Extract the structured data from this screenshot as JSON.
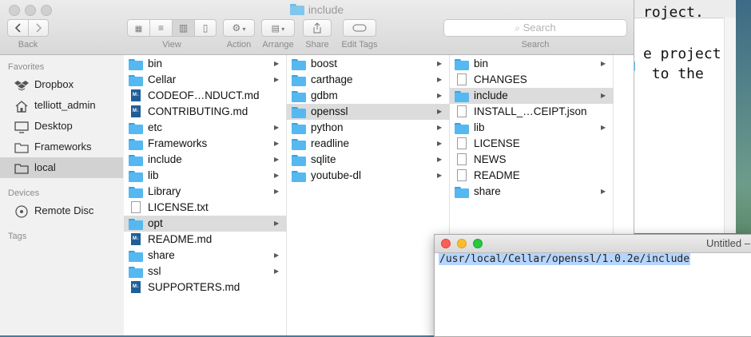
{
  "finder": {
    "title": "include",
    "toolbar": {
      "back_label": "Back",
      "view_label": "View",
      "action_label": "Action",
      "arrange_label": "Arrange",
      "share_label": "Share",
      "edit_tags_label": "Edit Tags",
      "search_placeholder": "Search",
      "search_label": "Search"
    },
    "sidebar": {
      "favorites_header": "Favorites",
      "favorites": [
        {
          "label": "Dropbox",
          "icon": "dropbox-icon"
        },
        {
          "label": "telliott_admin",
          "icon": "home-icon"
        },
        {
          "label": "Desktop",
          "icon": "desktop-icon"
        },
        {
          "label": "Frameworks",
          "icon": "folder-icon"
        },
        {
          "label": "local",
          "icon": "folder-icon",
          "selected": true
        }
      ],
      "devices_header": "Devices",
      "devices": [
        {
          "label": "Remote Disc",
          "icon": "disc-icon"
        }
      ],
      "tags_header": "Tags"
    },
    "columns": [
      {
        "items": [
          {
            "label": "bin",
            "type": "folder",
            "arrow": true
          },
          {
            "label": "Cellar",
            "type": "folder",
            "arrow": true
          },
          {
            "label": "CODEOF…NDUCT.md",
            "type": "md",
            "arrow": false
          },
          {
            "label": "CONTRIBUTING.md",
            "type": "md",
            "arrow": false
          },
          {
            "label": "etc",
            "type": "folder",
            "arrow": true
          },
          {
            "label": "Frameworks",
            "type": "folder",
            "arrow": true
          },
          {
            "label": "include",
            "type": "folder",
            "arrow": true
          },
          {
            "label": "lib",
            "type": "folder",
            "arrow": true
          },
          {
            "label": "Library",
            "type": "folder",
            "arrow": true
          },
          {
            "label": "LICENSE.txt",
            "type": "doc",
            "arrow": false
          },
          {
            "label": "opt",
            "type": "folder",
            "arrow": true,
            "selected": true
          },
          {
            "label": "README.md",
            "type": "md",
            "arrow": false
          },
          {
            "label": "share",
            "type": "folder",
            "arrow": true
          },
          {
            "label": "ssl",
            "type": "folder",
            "arrow": true
          },
          {
            "label": "SUPPORTERS.md",
            "type": "md",
            "arrow": false
          }
        ]
      },
      {
        "items": [
          {
            "label": "boost",
            "type": "folder",
            "arrow": true
          },
          {
            "label": "carthage",
            "type": "folder",
            "arrow": true
          },
          {
            "label": "gdbm",
            "type": "folder",
            "arrow": true
          },
          {
            "label": "openssl",
            "type": "folder",
            "arrow": true,
            "selected": true
          },
          {
            "label": "python",
            "type": "folder",
            "arrow": true
          },
          {
            "label": "readline",
            "type": "folder",
            "arrow": true
          },
          {
            "label": "sqlite",
            "type": "folder",
            "arrow": true
          },
          {
            "label": "youtube-dl",
            "type": "folder",
            "arrow": true
          }
        ]
      },
      {
        "items": [
          {
            "label": "bin",
            "type": "folder",
            "arrow": true
          },
          {
            "label": "CHANGES",
            "type": "doc",
            "arrow": false
          },
          {
            "label": "include",
            "type": "folder",
            "arrow": true,
            "selected": true
          },
          {
            "label": "INSTALL_…CEIPT.json",
            "type": "doc",
            "arrow": false
          },
          {
            "label": "lib",
            "type": "folder",
            "arrow": true
          },
          {
            "label": "LICENSE",
            "type": "doc",
            "arrow": false
          },
          {
            "label": "NEWS",
            "type": "doc",
            "arrow": false
          },
          {
            "label": "README",
            "type": "doc",
            "arrow": false
          },
          {
            "label": "share",
            "type": "folder",
            "arrow": true
          }
        ]
      }
    ]
  },
  "background_editor": {
    "lines": [
      "roject.",
      "e project",
      " to the"
    ]
  },
  "editor": {
    "title": "Untitled –",
    "text": "/usr/local/Cellar/openssl/1.0.2e/include"
  },
  "colors": {
    "folder_blue": "#56b8f0",
    "selection_blue": "#b5d5fd",
    "close_red": "#fd5f57",
    "minimize_yellow": "#febc2e",
    "zoom_green": "#28c840"
  }
}
